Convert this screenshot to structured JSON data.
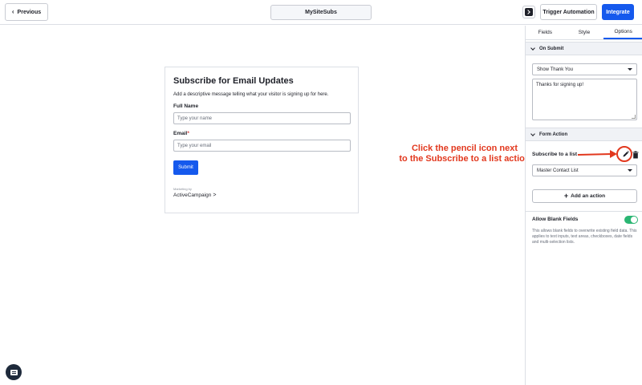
{
  "topbar": {
    "previous_label": "Previous",
    "site_name": "MySiteSubs",
    "trigger_label": "Trigger Automation",
    "integrate_label": "Integrate"
  },
  "form": {
    "title": "Subscribe for Email Updates",
    "description": "Add a descriptive message telling what your visitor is signing up for here.",
    "full_name_label": "Full Name",
    "full_name_placeholder": "Type your name",
    "email_label": "Email",
    "email_required_mark": "*",
    "email_placeholder": "Type your email",
    "submit_label": "Submit",
    "marketing_by": "Marketing by",
    "brand": "ActiveCampaign",
    "brand_mark": ">"
  },
  "annotation": {
    "text_line1": "Click the pencil icon next",
    "text_line2": "to the Subscribe to a list action",
    "color": "#e2381e"
  },
  "sidebar": {
    "tabs": [
      {
        "label": "Fields"
      },
      {
        "label": "Style"
      },
      {
        "label": "Options"
      }
    ],
    "active_tab": "Options",
    "on_submit": {
      "heading": "On Submit",
      "selected": "Show Thank You",
      "message": "Thanks for signing up!"
    },
    "form_action": {
      "heading": "Form Action",
      "action_label": "Subscribe to a list",
      "list_selected": "Master Contact List",
      "add_action_label": "Add an action"
    },
    "blank_fields": {
      "label": "Allow Blank Fields",
      "enabled": true,
      "description": "This allows blank fields to overwrite existing field data. This applies to text inputs, text areas, checkboxes, date fields and multi-selection lists."
    }
  },
  "icons": {
    "previous": "chevron-left-icon",
    "terminal": "terminal-icon",
    "pencil": "pencil-icon",
    "trash": "trash-icon",
    "chat": "chat-icon",
    "plus": "plus-icon"
  },
  "colors": {
    "accent": "#1559ed",
    "toggle_on": "#2bb673",
    "annotation_red": "#e2381e"
  }
}
